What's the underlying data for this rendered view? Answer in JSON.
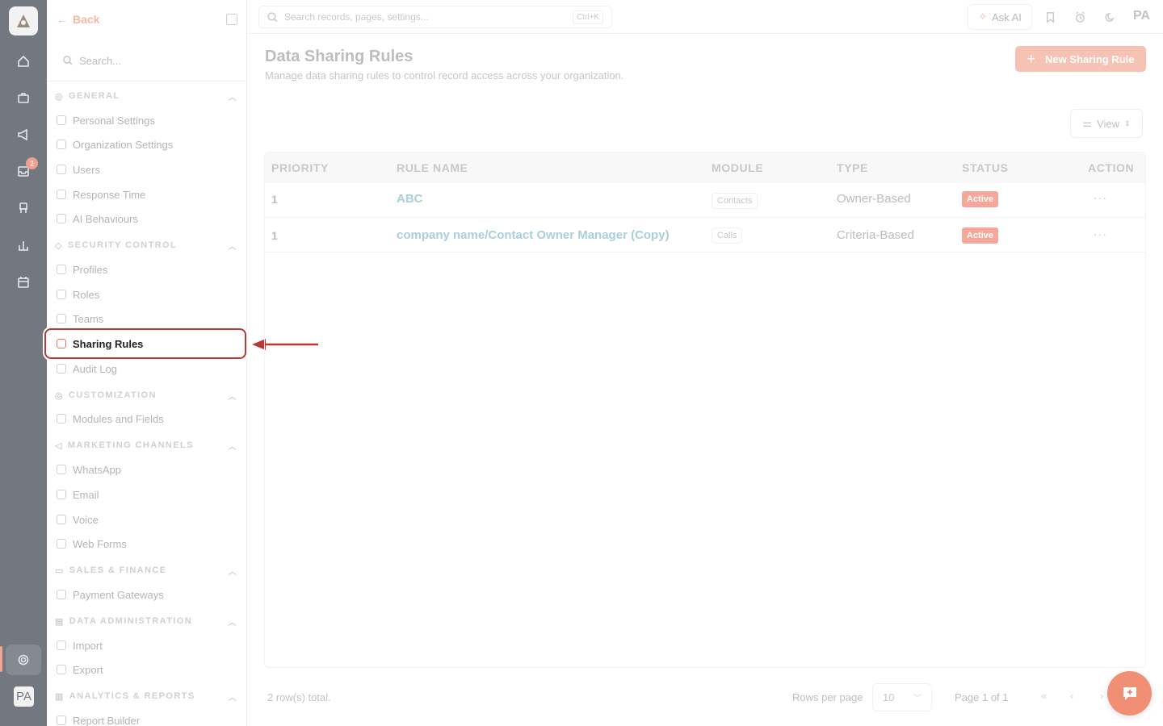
{
  "rail": {
    "icons": [
      "app-logo-icon",
      "home-icon",
      "briefcase-icon",
      "megaphone-icon",
      "inbox-icon",
      "chair-icon",
      "bar-chart-icon",
      "calendar-icon",
      "gear-icon"
    ],
    "inbox_badge": "2",
    "avatar": "PA"
  },
  "sidebar": {
    "back_label": "Back",
    "search_placeholder": "Search...",
    "sections": [
      {
        "title": "GENERAL",
        "items": [
          "Personal Settings",
          "Organization Settings",
          "Users",
          "Response Time",
          "AI Behaviours"
        ]
      },
      {
        "title": "SECURITY CONTROL",
        "items": [
          "Profiles",
          "Roles",
          "Teams",
          "Sharing Rules",
          "Audit Log"
        ]
      },
      {
        "title": "CUSTOMIZATION",
        "items": [
          "Modules and Fields"
        ]
      },
      {
        "title": "MARKETING CHANNELS",
        "items": [
          "WhatsApp",
          "Email",
          "Voice",
          "Web Forms"
        ]
      },
      {
        "title": "SALES & FINANCE",
        "items": [
          "Payment Gateways"
        ]
      },
      {
        "title": "DATA ADMINISTRATION",
        "items": [
          "Import",
          "Export"
        ]
      },
      {
        "title": "ANALYTICS & REPORTS",
        "items": [
          "Report Builder"
        ]
      }
    ],
    "active_item": "Sharing Rules"
  },
  "topbar": {
    "search_placeholder": "Search records, pages, settings...",
    "shortcut": "Ctrl+K",
    "ask_ai": "Ask AI",
    "user_initials": "PA"
  },
  "page": {
    "title": "Data Sharing Rules",
    "subtitle": "Manage data sharing rules to control record access across your organization.",
    "new_button": "New Sharing Rule",
    "view_button": "View"
  },
  "table": {
    "columns": [
      "PRIORITY",
      "RULE NAME",
      "MODULE",
      "TYPE",
      "STATUS",
      "ACTION"
    ],
    "rows": [
      {
        "priority": "1",
        "rule_name": "ABC",
        "module": "Contacts",
        "type": "Owner-Based",
        "status": "Active",
        "action": "···"
      },
      {
        "priority": "1",
        "rule_name": "company name/Contact Owner Manager (Copy)",
        "module": "Calls",
        "type": "Criteria-Based",
        "status": "Active",
        "action": "···"
      }
    ]
  },
  "footer": {
    "total": "2 row(s) total.",
    "rows_per_page_label": "Rows per page",
    "rows_per_page_value": "10",
    "page_info": "Page 1 of 1",
    "first_page": "«",
    "prev_page": "‹",
    "next_page": "›"
  },
  "colors": {
    "accent": "#f08f74",
    "highlight_border": "#b83a32",
    "rail_bg": "#737880",
    "link": "#a9cfdc",
    "status_active": "#f6a69a"
  }
}
